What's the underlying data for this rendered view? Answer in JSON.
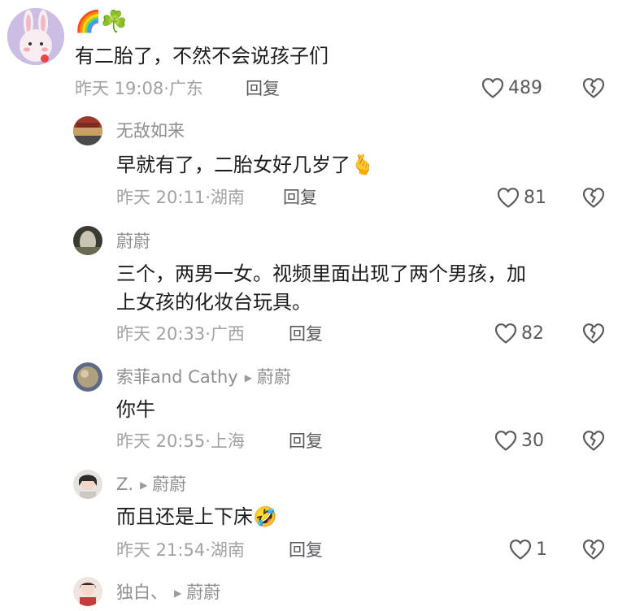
{
  "comments": [
    {
      "username": "🌈☘️",
      "text": "有二胎了，不然不会说孩子们",
      "time": "昨天 19:08",
      "location": "广东",
      "reply_label": "回复",
      "likes": "489"
    },
    {
      "username": "无敌如来",
      "text": "早就有了，二胎女好几岁了🫰",
      "time": "昨天 20:11",
      "location": "湖南",
      "reply_label": "回复",
      "likes": "81"
    },
    {
      "username": "蔚蔚",
      "text_line1": "三个，两男一女。视频里面出现了两个男孩，加",
      "text_line2": "上女孩的化妆台玩具。",
      "time": "昨天 20:33",
      "location": "广西",
      "reply_label": "回复",
      "likes": "82"
    },
    {
      "username": "索菲and Cathy",
      "reply_to": "蔚蔚",
      "text": "你牛",
      "time": "昨天 20:55",
      "location": "上海",
      "reply_label": "回复",
      "likes": "30"
    },
    {
      "username": "Z.",
      "reply_to": "蔚蔚",
      "text": "而且还是上下床🤣",
      "time": "昨天 21:54",
      "location": "湖南",
      "reply_label": "回复",
      "likes": "1"
    },
    {
      "username": "独白、",
      "reply_to": "蔚蔚"
    }
  ],
  "icons": {
    "like": "heart-outline-icon",
    "dislike": "broken-heart-icon",
    "reply_arrow": "play-triangle-icon"
  },
  "colors": {
    "text_primary": "#1c1c1e",
    "text_secondary": "#8e8e93",
    "icon": "#5a5a60",
    "background": "#ffffff"
  }
}
